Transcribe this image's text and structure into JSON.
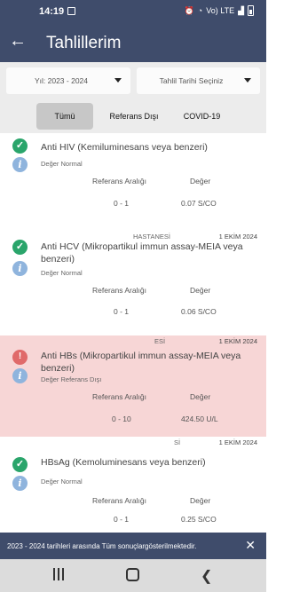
{
  "status_bar": {
    "time": "14:19",
    "signal": "Vo) LTE"
  },
  "app_bar": {
    "back_icon": "arrow-left-icon",
    "title": "Tahlillerim"
  },
  "filters": {
    "year_label": "Yıl: 2023 - 2024",
    "date_label": "Tahlil Tarihi Seçiniz"
  },
  "tabs": [
    {
      "label": "Tümü",
      "active": true
    },
    {
      "label": "Referans Dışı",
      "active": false
    },
    {
      "label": "COVID-19",
      "active": false
    }
  ],
  "columns": {
    "range": "Referans Aralığı",
    "value": "Değer"
  },
  "results": [
    {
      "name": "Anti HIV (Kemiluminesans veya benzeri)",
      "status": "Değer Normal",
      "range": "0 - 1",
      "value": "0.07 S/CO",
      "hospital": "",
      "date": ""
    },
    {
      "name": "Anti HCV (Mikropartikul immun assay-MEIA veya benzeri)",
      "status": "Değer Normal",
      "range": "0 - 1",
      "value": "0.06 S/CO",
      "hospital": "HASTANESİ",
      "date": "1 EKİM 2024"
    },
    {
      "name": "Anti HBs (Mikropartikul immun assay-MEIA veya benzeri)",
      "status": "Değer Referans Dışı",
      "range": "0 - 10",
      "value": "424.50 U/L",
      "hospital": "ESİ",
      "date": "1 EKİM 2024"
    },
    {
      "name": "HBsAg (Kemoluminesans veya benzeri)",
      "status": "Değer Normal",
      "range": "0 - 1",
      "value": "0.25 S/CO",
      "hospital": "Sİ",
      "date": "1 EKİM 2024"
    }
  ],
  "snackbar": {
    "message": "2023 - 2024 tarihleri arasında Tüm sonuçlargösterilmektedir.",
    "close_icon": "close-icon"
  },
  "colors": {
    "primary": "#3f4c6b",
    "ok": "#2aa56b",
    "warn": "#e06a6a",
    "alert_bg": "#f7d6d6",
    "info": "#8fb4dd"
  }
}
